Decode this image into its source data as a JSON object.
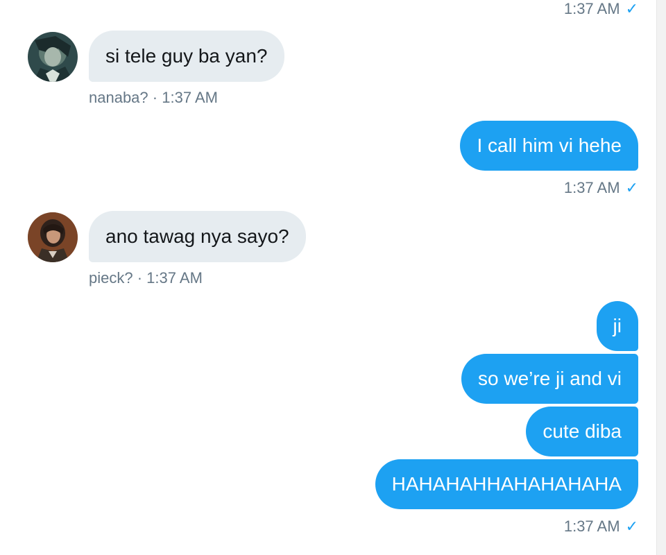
{
  "messages": {
    "top_status": {
      "time": "1:37 AM",
      "read": "✓"
    },
    "recv1": {
      "text": "si tele guy ba yan?",
      "sender": "nanaba?",
      "sep": "·",
      "time": "1:37 AM",
      "avatar": "avatar-nanaba"
    },
    "sent1": {
      "text": "I call him vi hehe",
      "time": "1:37 AM",
      "read": "✓"
    },
    "recv2": {
      "text": "ano tawag nya sayo?",
      "sender": "pieck?",
      "sep": "·",
      "time": "1:37 AM",
      "avatar": "avatar-pieck"
    },
    "sent_group": [
      {
        "text": "ji"
      },
      {
        "text": "so we’re ji and vi"
      },
      {
        "text": "cute diba"
      },
      {
        "text": "HAHAHAHHAHAHAHAHA"
      }
    ],
    "sent_group_status": {
      "time": "1:37 AM",
      "read": "✓"
    }
  },
  "colors": {
    "sent_bubble": "#1da1f2",
    "received_bubble": "#e6ecf0",
    "meta_text": "#657786",
    "read_check": "#1da1f2"
  },
  "icons": {
    "read_receipt": "check-icon"
  }
}
